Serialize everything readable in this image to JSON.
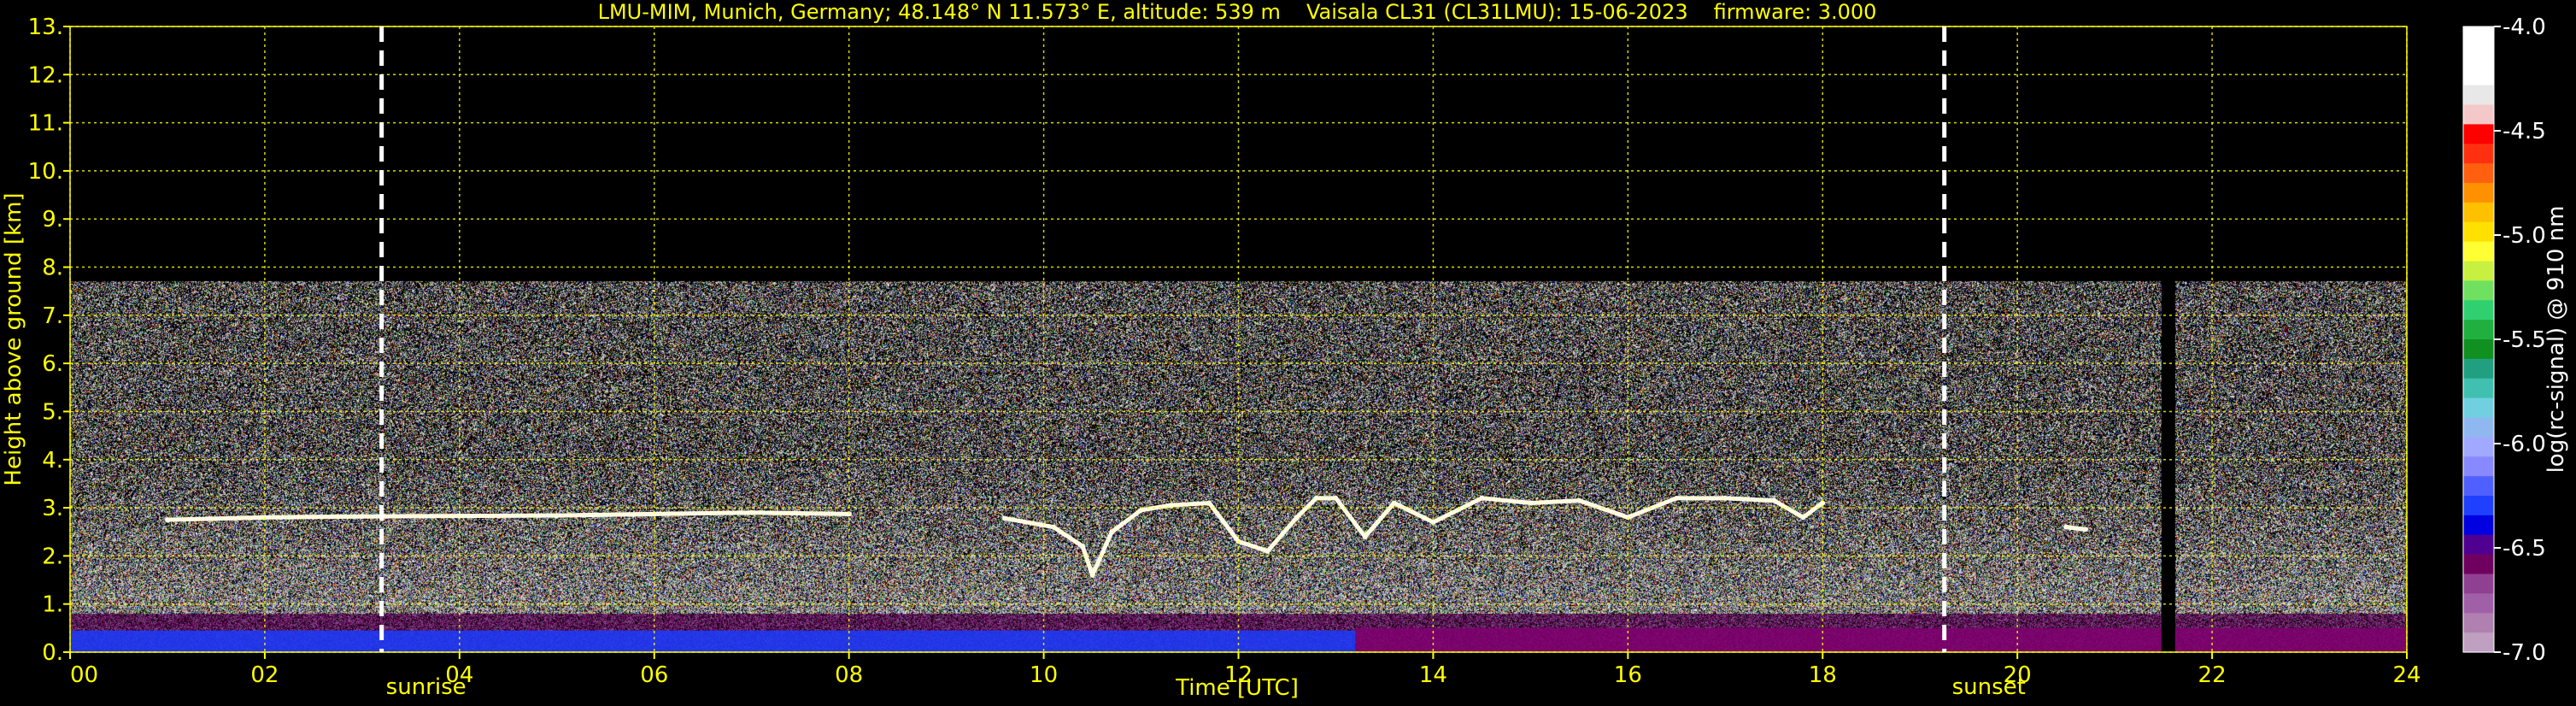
{
  "chart_data": {
    "type": "heatmap",
    "title": {
      "site": "LMU-MIM, Munich, Germany; 48.148° N 11.573° E, altitude: 539 m",
      "instrument": "Vaisala CL31 (CL31LMU): 15-06-2023",
      "firmware": "firmware: 3.000"
    },
    "xlabel": "Time [UTC]",
    "ylabel": "Height above ground [km]",
    "xlim": [
      0,
      24
    ],
    "ylim": [
      0,
      13
    ],
    "x_ticks": [
      0,
      2,
      4,
      6,
      8,
      10,
      12,
      14,
      16,
      18,
      20,
      22,
      24
    ],
    "x_tick_labels": [
      "00",
      "02",
      "04",
      "06",
      "08",
      "10",
      "12",
      "14",
      "16",
      "18",
      "20",
      "22",
      "24"
    ],
    "y_ticks": [
      0,
      1,
      2,
      3,
      4,
      5,
      6,
      7,
      8,
      9,
      10,
      11,
      12,
      13
    ],
    "y_tick_labels": [
      "0.",
      "1.",
      "2.",
      "3.",
      "4.",
      "5.",
      "6.",
      "7.",
      "8.",
      "9.",
      "10.",
      "11.",
      "12.",
      "13."
    ],
    "grid": true,
    "grid_color": "#ffff00",
    "data_top_km": 7.7,
    "events": [
      {
        "label": "sunrise",
        "time": 3.2
      },
      {
        "label": "sunset",
        "time": 19.25
      }
    ],
    "data_gaps": [
      {
        "from": 21.48,
        "to": 21.62
      }
    ],
    "cloud_layer": [
      [
        1.0,
        2.75
      ],
      [
        2.0,
        2.8
      ],
      [
        3.0,
        2.82
      ],
      [
        4.0,
        2.83
      ],
      [
        5.0,
        2.84
      ],
      [
        6.0,
        2.87
      ],
      [
        7.0,
        2.9
      ],
      [
        8.0,
        2.87
      ],
      [
        9.6,
        2.78
      ],
      [
        10.1,
        2.6
      ],
      [
        10.4,
        2.2
      ],
      [
        10.5,
        1.6
      ],
      [
        10.7,
        2.5
      ],
      [
        11.0,
        2.95
      ],
      [
        11.3,
        3.05
      ],
      [
        11.7,
        3.1
      ],
      [
        12.0,
        2.3
      ],
      [
        12.3,
        2.1
      ],
      [
        12.6,
        2.8
      ],
      [
        12.8,
        3.2
      ],
      [
        13.0,
        3.2
      ],
      [
        13.3,
        2.4
      ],
      [
        13.6,
        3.1
      ],
      [
        14.0,
        2.7
      ],
      [
        14.5,
        3.2
      ],
      [
        15.0,
        3.1
      ],
      [
        15.5,
        3.15
      ],
      [
        16.0,
        2.8
      ],
      [
        16.5,
        3.2
      ],
      [
        17.0,
        3.2
      ],
      [
        17.5,
        3.15
      ],
      [
        17.8,
        2.8
      ],
      [
        18.0,
        3.1
      ],
      [
        20.5,
        2.6
      ],
      [
        20.7,
        2.55
      ]
    ],
    "colorbar": {
      "label": "log(rc-signal) @ 910 nm",
      "min": -7.0,
      "max": -4.0,
      "ticks": [
        -4.0,
        -4.5,
        -5.0,
        -5.5,
        -6.0,
        -6.5,
        -7.0
      ],
      "tick_labels": [
        "-4.0",
        "-4.5",
        "-5.0",
        "-5.5",
        "-6.0",
        "-6.5",
        "-7.0"
      ],
      "colors": [
        "#ffffff",
        "#ffffff",
        "#ffffff",
        "#e8e8e8",
        "#f4c8c8",
        "#ff0000",
        "#ff3010",
        "#ff6010",
        "#ff9000",
        "#ffc000",
        "#ffe000",
        "#ffff33",
        "#c8f040",
        "#70e060",
        "#30d070",
        "#20b040",
        "#109020",
        "#20a080",
        "#40c0b0",
        "#70d0e0",
        "#90b8f0",
        "#a0a8ff",
        "#8888ff",
        "#5060ff",
        "#2040ff",
        "#0000e0",
        "#500090",
        "#700060",
        "#904090",
        "#a060a8",
        "#b080b0",
        "#c0a0c0"
      ]
    }
  }
}
